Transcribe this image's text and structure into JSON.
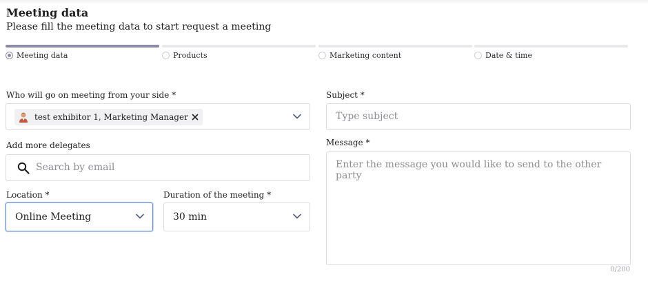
{
  "header": {
    "title": "Meeting data",
    "subtitle": "Please fill the meeting data to start request a meeting"
  },
  "stepper": {
    "steps": [
      {
        "label": "Meeting data",
        "active": true
      },
      {
        "label": "Products",
        "active": false
      },
      {
        "label": "Marketing content",
        "active": false
      },
      {
        "label": "Date & time",
        "active": false
      }
    ]
  },
  "form": {
    "attendees": {
      "label": "Who will go on meeting from your side *",
      "selected": "test exhibitor 1, Marketing Manager"
    },
    "delegates": {
      "label": "Add more delegates",
      "placeholder": "Search by email"
    },
    "location": {
      "label": "Location *",
      "value": "Online Meeting"
    },
    "duration": {
      "label": "Duration of the meeting *",
      "value": "30 min"
    },
    "subject": {
      "label": "Subject *",
      "placeholder": "Type subject"
    },
    "message": {
      "label": "Message *",
      "placeholder": "Enter the message you would like to send to the other party",
      "counter": "0/200"
    }
  },
  "colors": {
    "accent": "#8c8aa7",
    "border": "#dcdce0",
    "focus": "#6b8fcf",
    "placeholder": "#8e8e93"
  }
}
